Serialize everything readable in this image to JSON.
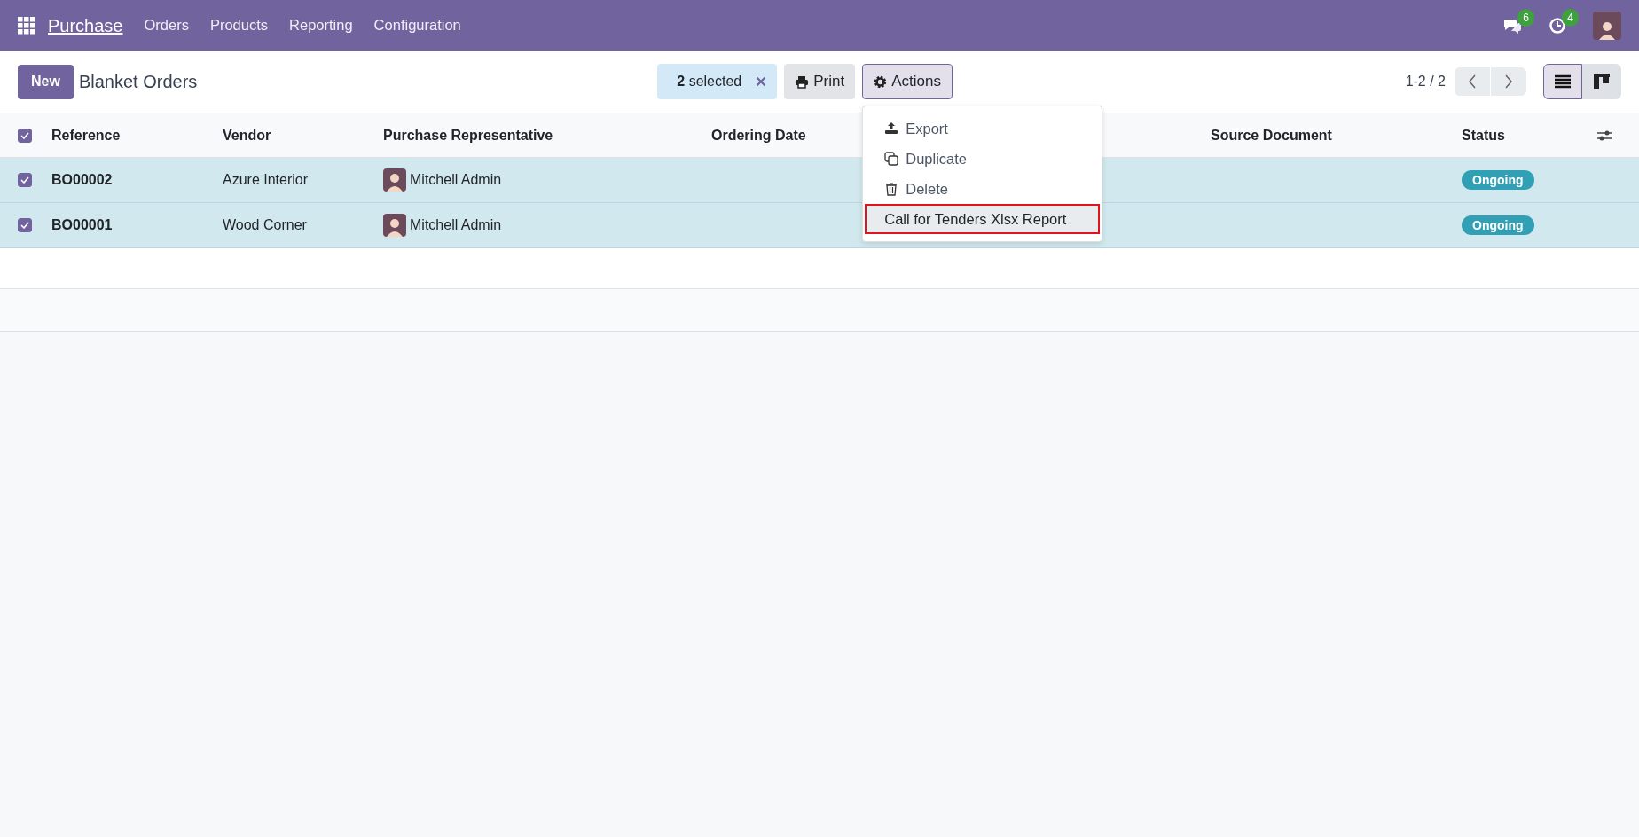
{
  "navbar": {
    "app_name": "Purchase",
    "menu": [
      "Orders",
      "Products",
      "Reporting",
      "Configuration"
    ],
    "messages_count": "6",
    "activities_count": "4"
  },
  "control_panel": {
    "new_button": "New",
    "title": "Blanket Orders",
    "selection": {
      "count": "2",
      "label": "selected"
    },
    "print_button": "Print",
    "actions_button": "Actions",
    "pager": "1-2 / 2",
    "views": [
      {
        "kind": "list",
        "selected": true
      },
      {
        "kind": "kanban",
        "selected": false
      }
    ]
  },
  "actions_menu": {
    "items": [
      {
        "kind": "export",
        "label": "Export",
        "highlighted": false
      },
      {
        "kind": "duplicate",
        "label": "Duplicate",
        "highlighted": false
      },
      {
        "kind": "delete",
        "label": "Delete",
        "highlighted": false
      },
      {
        "kind": "report",
        "label": "Call for Tenders Xlsx Report",
        "highlighted": true
      }
    ]
  },
  "table": {
    "select_all_checked": true,
    "columns": [
      "Reference",
      "Vendor",
      "Purchase Representative",
      "Ordering Date",
      "Source Document",
      "Status"
    ],
    "rows": [
      {
        "checked": true,
        "reference": "BO00002",
        "vendor": "Azure Interior",
        "representative": "Mitchell Admin",
        "status": "Ongoing"
      },
      {
        "checked": true,
        "reference": "BO00001",
        "vendor": "Wood Corner",
        "representative": "Mitchell Admin",
        "status": "Ongoing"
      }
    ]
  }
}
